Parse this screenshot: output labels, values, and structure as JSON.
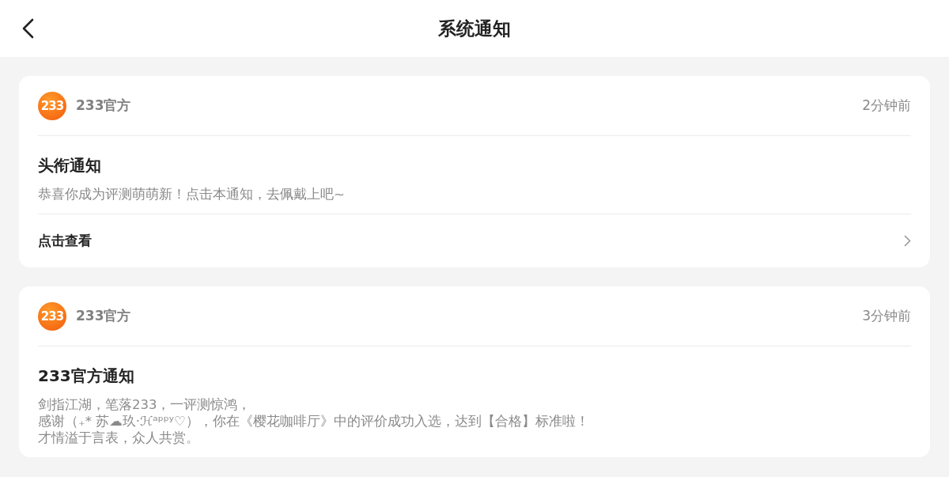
{
  "header": {
    "title": "系统通知"
  },
  "notifications": [
    {
      "logo": "233",
      "sender": "233官方",
      "time": "2分钟前",
      "title": "头衔通知",
      "lines": [
        "恭喜你成为评测萌萌新！点击本通知，去佩戴上吧~"
      ],
      "action": "点击查看"
    },
    {
      "logo": "233",
      "sender": "233官方",
      "time": "3分钟前",
      "title": "233官方通知",
      "lines": [
        "剑指江湖，笔落233，一评测惊鸿，",
        "感谢（₊* 苏☁玖·ℋᵃᵖᵖʸ♡），你在《樱花咖啡厅》中的评价成功入选，达到【合格】标准啦！",
        "才情溢于言表，众人共赏。"
      ]
    }
  ]
}
